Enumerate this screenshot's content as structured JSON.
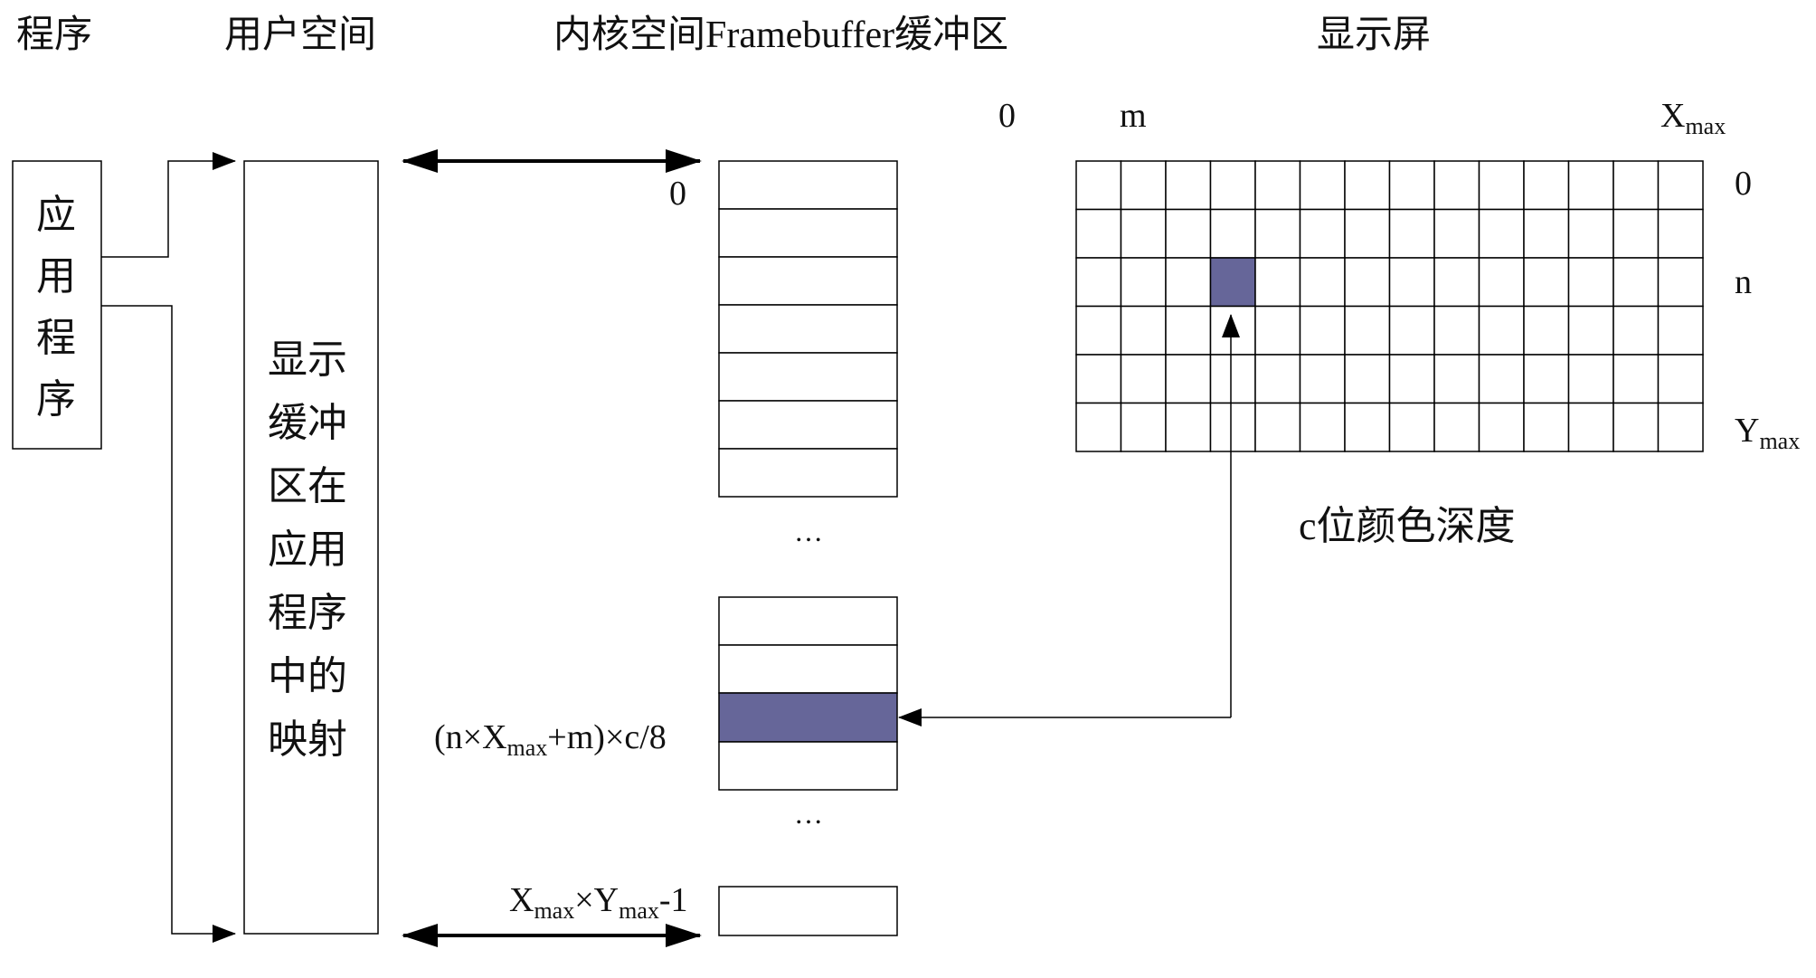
{
  "headers": {
    "program": "程序",
    "user_space": "用户空间",
    "kernel_space": "内核空间Framebuffer缓冲区",
    "display": "显示屏"
  },
  "app_box": {
    "chars": [
      "应",
      "用",
      "程",
      "序"
    ]
  },
  "mapping_box": {
    "lines": [
      "显示",
      "缓冲",
      "区在",
      "应用",
      "程序",
      "中的",
      "映射"
    ]
  },
  "buffer": {
    "index_zero": "0",
    "ellipsis": "…",
    "offset_label": {
      "prefix": "(n×X",
      "sub": "max",
      "suffix": "+m)×c/8"
    },
    "last_label": {
      "x": "X",
      "x_sub": "max",
      "times": "×Y",
      "y_sub": "max",
      "tail": "-1"
    }
  },
  "screen": {
    "x_axis": {
      "zero": "0",
      "m": "m",
      "xmax": "X",
      "xmax_sub": "max"
    },
    "y_axis": {
      "zero": "0",
      "n": "n",
      "ymax": "Y",
      "ymax_sub": "max"
    },
    "cols": 14,
    "rows": 6,
    "highlight_col": 3,
    "highlight_row": 2,
    "caption": "c位颜色深度"
  },
  "colors": {
    "highlight": "#666699",
    "line": "#000000"
  }
}
